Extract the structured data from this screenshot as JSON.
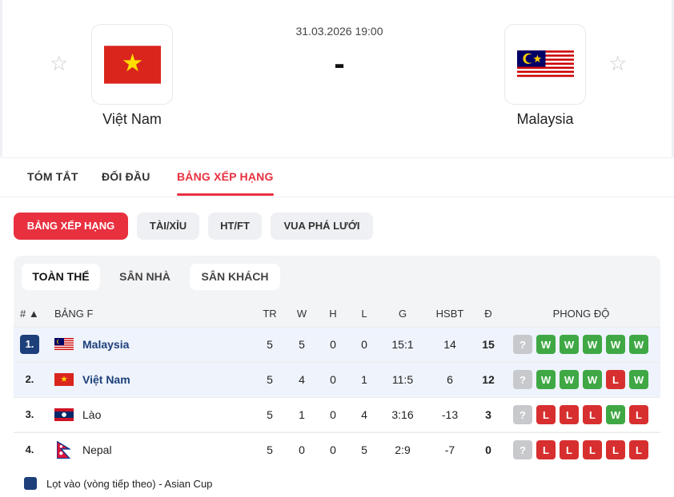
{
  "match": {
    "datetime": "31.03.2026 19:00",
    "score": "-",
    "home": {
      "name": "Việt Nam",
      "star": "☆"
    },
    "away": {
      "name": "Malaysia",
      "star": "☆"
    }
  },
  "tabs": [
    {
      "label": "TÓM TẮT",
      "active": false
    },
    {
      "label": "ĐỐI ĐẦU",
      "active": false
    },
    {
      "label": "BẢNG XẾP HẠNG",
      "active": true
    }
  ],
  "subtabs": [
    {
      "label": "BẢNG XẾP HẠNG",
      "active": true
    },
    {
      "label": "TÀI/XỈU",
      "active": false
    },
    {
      "label": "HT/FT",
      "active": false
    },
    {
      "label": "VUA PHÁ LƯỚI",
      "active": false
    }
  ],
  "scope": [
    {
      "label": "TOÀN THỂ",
      "active": true
    },
    {
      "label": "SÂN NHÀ",
      "active": false
    },
    {
      "label": "SÂN KHÁCH",
      "active": false
    }
  ],
  "table": {
    "headers": {
      "rank": "# ▲",
      "group": "BẢNG F",
      "tr": "TR",
      "w": "W",
      "h": "H",
      "l": "L",
      "g": "G",
      "hsbt": "HSBT",
      "pts": "Đ",
      "form": "PHONG ĐỘ"
    },
    "rows": [
      {
        "rank": "1.",
        "team": "Malaysia",
        "flag": "malaysia-flag",
        "tr": "5",
        "w": "5",
        "h": "0",
        "l": "0",
        "g": "15:1",
        "hsbt": "14",
        "pts": "15",
        "form": [
          "?",
          "W",
          "W",
          "W",
          "W",
          "W"
        ]
      },
      {
        "rank": "2.",
        "team": "Việt Nam",
        "flag": "vietnam-flag",
        "tr": "5",
        "w": "4",
        "h": "0",
        "l": "1",
        "g": "11:5",
        "hsbt": "6",
        "pts": "12",
        "form": [
          "?",
          "W",
          "W",
          "W",
          "L",
          "W"
        ]
      },
      {
        "rank": "3.",
        "team": "Lào",
        "flag": "laos-flag",
        "tr": "5",
        "w": "1",
        "h": "0",
        "l": "4",
        "g": "3:16",
        "hsbt": "-13",
        "pts": "3",
        "form": [
          "?",
          "L",
          "L",
          "L",
          "W",
          "L"
        ]
      },
      {
        "rank": "4.",
        "team": "Nepal",
        "flag": "nepal-flag",
        "tr": "5",
        "w": "0",
        "h": "0",
        "l": "5",
        "g": "2:9",
        "hsbt": "-7",
        "pts": "0",
        "form": [
          "?",
          "L",
          "L",
          "L",
          "L",
          "L"
        ]
      }
    ]
  },
  "legend": {
    "label": "Lọt vào (vòng tiếp theo) - Asian Cup",
    "color": "#1d3f7a"
  },
  "colors": {
    "accent": "#e8303f",
    "win": "#3fa845",
    "loss": "#d72f2f",
    "qualify": "#1d3f7a"
  }
}
